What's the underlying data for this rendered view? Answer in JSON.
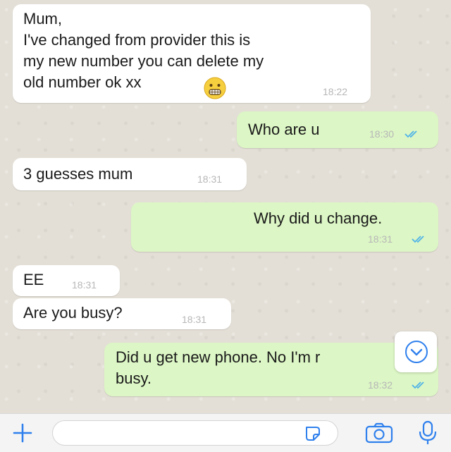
{
  "messages": [
    {
      "direction": "incoming",
      "text": "Mum,\nI've changed from provider this is\nmy new number you can delete my\nold number ok xx",
      "emoji": "grimacing-emoji",
      "time": "18:22"
    },
    {
      "direction": "outgoing",
      "text": "Who are u",
      "time": "18:30",
      "status": "read"
    },
    {
      "direction": "incoming",
      "text": "3 guesses mum",
      "time": "18:31"
    },
    {
      "direction": "outgoing",
      "text": "Why did u change.",
      "time": "18:31",
      "status": "read"
    },
    {
      "direction": "incoming",
      "text": "EE",
      "time": "18:31"
    },
    {
      "direction": "incoming",
      "text": "Are you busy?",
      "time": "18:31"
    },
    {
      "direction": "outgoing",
      "text": "Did u get new phone. No I'm r\nbusy.",
      "time": "18:32",
      "status": "read"
    }
  ],
  "input_bar": {
    "placeholder": "",
    "icons": [
      "plus-icon",
      "sticker-icon",
      "camera-icon",
      "microphone-icon"
    ]
  },
  "scroll_button": {
    "icon": "chevron-down-icon"
  },
  "colors": {
    "incoming_bubble": "#ffffff",
    "outgoing_bubble": "#dcf6c5",
    "read_ticks": "#4fb3e8",
    "accent": "#2f80ed",
    "timestamp": "#b7b7b7"
  }
}
